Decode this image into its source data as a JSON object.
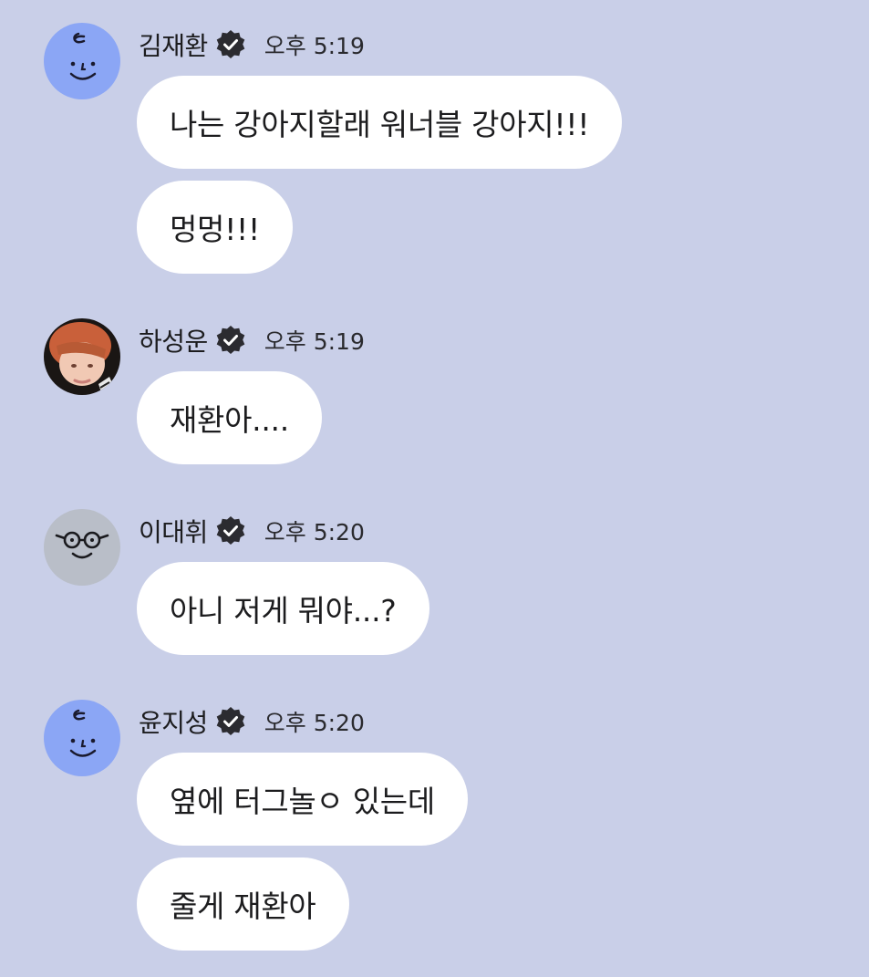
{
  "colors": {
    "background": "#c9cfe8",
    "bubble": "#ffffff",
    "verified_badge": "#2b2b30",
    "text": "#1c1c1e"
  },
  "messages": [
    {
      "sender": "김재환",
      "avatar_icon": "smiley-doodle-avatar-icon",
      "verified": true,
      "time": "오후 5:19",
      "bubbles": [
        "나는 강아지할래 워너블 강아지!!!",
        "멍멍!!!"
      ]
    },
    {
      "sender": "하성운",
      "avatar_icon": "profile-photo-avatar",
      "verified": true,
      "time": "오후 5:19",
      "bubbles": [
        "재환아...."
      ]
    },
    {
      "sender": "이대휘",
      "avatar_icon": "glasses-face-avatar-icon",
      "verified": true,
      "time": "오후 5:20",
      "bubbles": [
        "아니 저게 뭐야...?"
      ]
    },
    {
      "sender": "윤지성",
      "avatar_icon": "smiley-doodle-avatar-icon",
      "verified": true,
      "time": "오후 5:20",
      "bubbles": [
        "옆에 터그놀ㅇ 있는데",
        "줄게 재환아"
      ]
    }
  ]
}
